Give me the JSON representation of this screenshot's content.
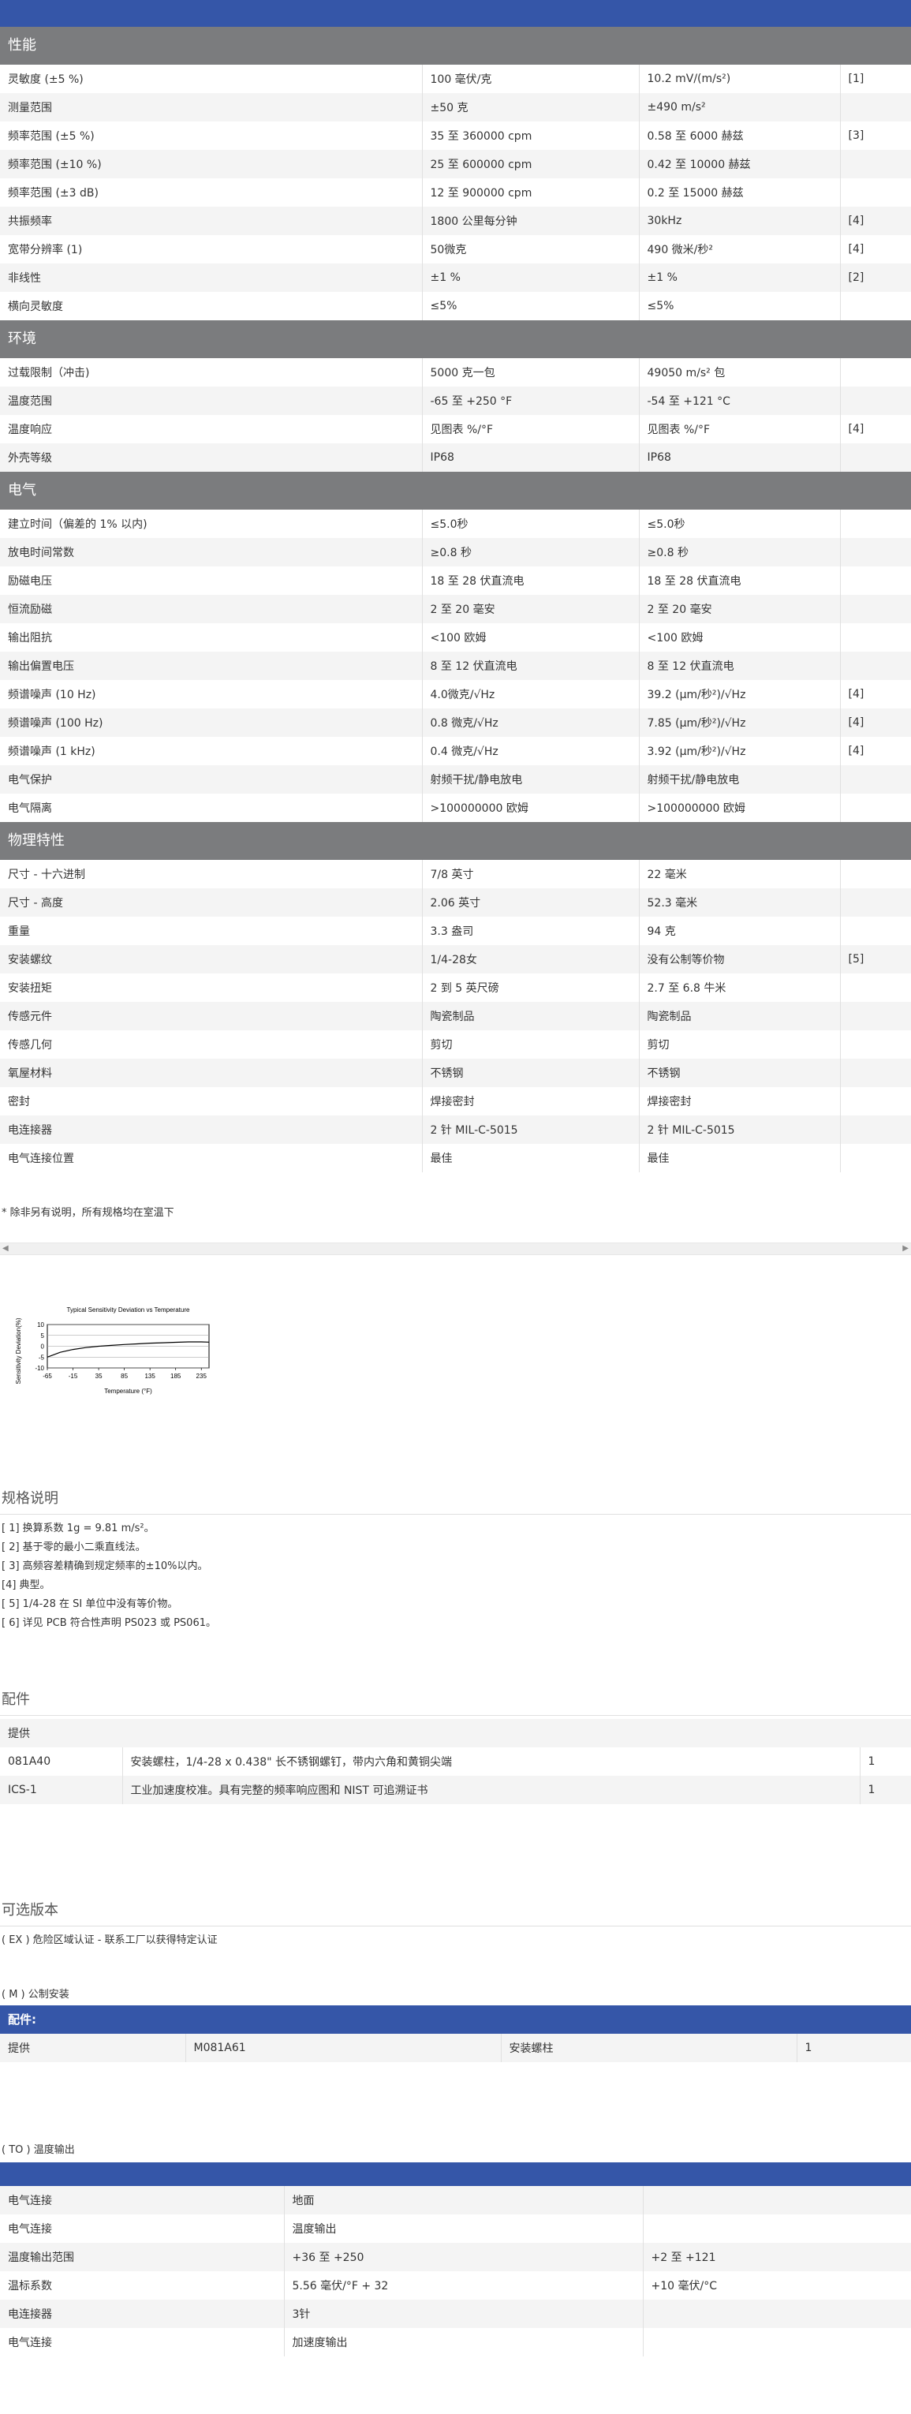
{
  "sections": [
    {
      "title": "性能",
      "rows": [
        [
          "灵敏度 (±5 %)",
          "100 毫伏/克",
          "10.2 mV/(m/s²)",
          "[1]"
        ],
        [
          "测量范围",
          "±50 克",
          "±490 m/s²",
          ""
        ],
        [
          "频率范围 (±5 %)",
          "35 至 360000 cpm",
          "0.58 至 6000 赫兹",
          "[3]"
        ],
        [
          "频率范围 (±10 %)",
          "25 至 600000 cpm",
          "0.42 至 10000 赫兹",
          ""
        ],
        [
          "频率范围 (±3 dB)",
          "12 至 900000 cpm",
          "0.2 至 15000 赫兹",
          ""
        ],
        [
          "共振频率",
          "1800 公里每分钟",
          "30kHz",
          "[4]"
        ],
        [
          "宽带分辨率 (1)",
          "50微克",
          "490 微米/秒²",
          "[4]"
        ],
        [
          "非线性",
          "±1 %",
          "±1 %",
          "[2]"
        ],
        [
          "横向灵敏度",
          "≤5%",
          "≤5%",
          ""
        ]
      ]
    },
    {
      "title": "环境",
      "rows": [
        [
          "过载限制（冲击)",
          "5000 克一包",
          "49050 m/s² 包",
          ""
        ],
        [
          "温度范围",
          "-65 至 +250 °F",
          "-54 至 +121 °C",
          ""
        ],
        [
          "温度响应",
          "见图表 %/°F",
          "见图表 %/°F",
          "[4]"
        ],
        [
          "外壳等级",
          "IP68",
          "IP68",
          ""
        ]
      ]
    },
    {
      "title": "电气",
      "rows": [
        [
          "建立时间（偏差的 1% 以内)",
          "≤5.0秒",
          "≤5.0秒",
          ""
        ],
        [
          "放电时间常数",
          "≥0.8 秒",
          "≥0.8 秒",
          ""
        ],
        [
          "励磁电压",
          "18 至 28 伏直流电",
          "18 至 28 伏直流电",
          ""
        ],
        [
          "恒流励磁",
          "2 至 20 毫安",
          "2 至 20 毫安",
          ""
        ],
        [
          "输出阻抗",
          "<100 欧姆",
          "<100 欧姆",
          ""
        ],
        [
          "输出偏置电压",
          "8 至 12 伏直流电",
          "8 至 12 伏直流电",
          ""
        ],
        [
          "频谱噪声 (10 Hz)",
          "4.0微克/√Hz",
          "39.2 (μm/秒²)/√Hz",
          "[4]"
        ],
        [
          "频谱噪声 (100 Hz)",
          "0.8 微克/√Hz",
          "7.85 (μm/秒²)/√Hz",
          "[4]"
        ],
        [
          "频谱噪声 (1 kHz)",
          "0.4 微克/√Hz",
          "3.92 (μm/秒²)/√Hz",
          "[4]"
        ],
        [
          "电气保护",
          "射频干扰/静电放电",
          "射频干扰/静电放电",
          ""
        ],
        [
          "电气隔离",
          ">100000000 欧姆",
          ">100000000 欧姆",
          ""
        ]
      ]
    },
    {
      "title": "物理特性",
      "rows": [
        [
          "尺寸 - 十六进制",
          "7/8 英寸",
          "22 毫米",
          ""
        ],
        [
          "尺寸 - 高度",
          "2.06 英寸",
          "52.3 毫米",
          ""
        ],
        [
          "重量",
          "3.3 盎司",
          "94 克",
          ""
        ],
        [
          "安装螺纹",
          "1/4-28女",
          "没有公制等价物",
          "[5]"
        ],
        [
          "安装扭矩",
          "2 到 5 英尺磅",
          "2.7 至 6.8 牛米",
          ""
        ],
        [
          "传感元件",
          "陶瓷制品",
          "陶瓷制品",
          ""
        ],
        [
          "传感几何",
          "剪切",
          "剪切",
          ""
        ],
        [
          "氧屋材料",
          "不锈钢",
          "不锈钢",
          ""
        ],
        [
          "密封",
          "焊接密封",
          "焊接密封",
          ""
        ],
        [
          "电连接器",
          "2 针 MIL-C-5015",
          "2 针 MIL-C-5015",
          ""
        ],
        [
          "电气连接位置",
          "最佳",
          "最佳",
          ""
        ]
      ]
    }
  ],
  "footnote": "* 除非另有说明，所有规格均在室温下",
  "chart_data": {
    "type": "line",
    "title": "Typical Sensitivity Deviation vs Temperature",
    "xlabel": "Temperature (°F)",
    "ylabel": "Sensitivity Deviation(%)",
    "x_ticks": [
      -65,
      -15,
      35,
      85,
      135,
      185,
      235
    ],
    "y_ticks": [
      10,
      5,
      0,
      -5,
      -10
    ],
    "xlim": [
      -65,
      250
    ],
    "ylim": [
      -10,
      10
    ],
    "series": [
      {
        "x": [
          -65,
          -40,
          -15,
          10,
          35,
          60,
          85,
          110,
          135,
          160,
          185,
          210,
          235,
          250
        ],
        "y": [
          -5,
          -2.8,
          -1.5,
          -0.6,
          0,
          0.4,
          0.8,
          1.1,
          1.4,
          1.6,
          1.8,
          2.0,
          2.0,
          1.9
        ]
      }
    ]
  },
  "notes_title": "规格说明",
  "notes": [
    "[ 1] 换算系数 1g = 9.81 m/s²。",
    "[ 2] 基于零的最小二乘直线法。",
    "[ 3] 高频容差精确到规定频率的±10%以内。",
    "[4] 典型。",
    "[ 5] 1/4-28 在 SI 单位中没有等价物。",
    "[ 6] 详见 PCB 符合性声明 PS023 或 PS061。"
  ],
  "accessories_title": "配件",
  "accessories_header": "提供",
  "accessories": [
    [
      "081A40",
      "安装螺柱，1/4-28 x 0.438\" 长不锈钢螺钉，带内六角和黄铜尖端",
      "1"
    ],
    [
      "ICS-1",
      "工业加速度校准。具有完整的频率响应图和 NIST 可追溯证书",
      "1"
    ]
  ],
  "options_title": "可选版本",
  "option_ex": "( EX ) 危险区域认证 - 联系工厂以获得特定认证",
  "option_m": "( M ) 公制安装",
  "option_m_bar": "配件:",
  "option_m_row": [
    "提供",
    "M081A61",
    "安装螺柱",
    "1"
  ],
  "option_to": "( TO ) 温度输出",
  "to_rows": [
    [
      "电气连接",
      "地面",
      ""
    ],
    [
      "电气连接",
      "温度输出",
      ""
    ],
    [
      "温度输出范围",
      "+36 至 +250",
      "+2 至 +121"
    ],
    [
      "温标系数",
      "5.56 毫伏/°F + 32",
      "+10 毫伏/°C"
    ],
    [
      "电连接器",
      "3针",
      ""
    ],
    [
      "电气连接",
      "加速度输出",
      ""
    ]
  ]
}
